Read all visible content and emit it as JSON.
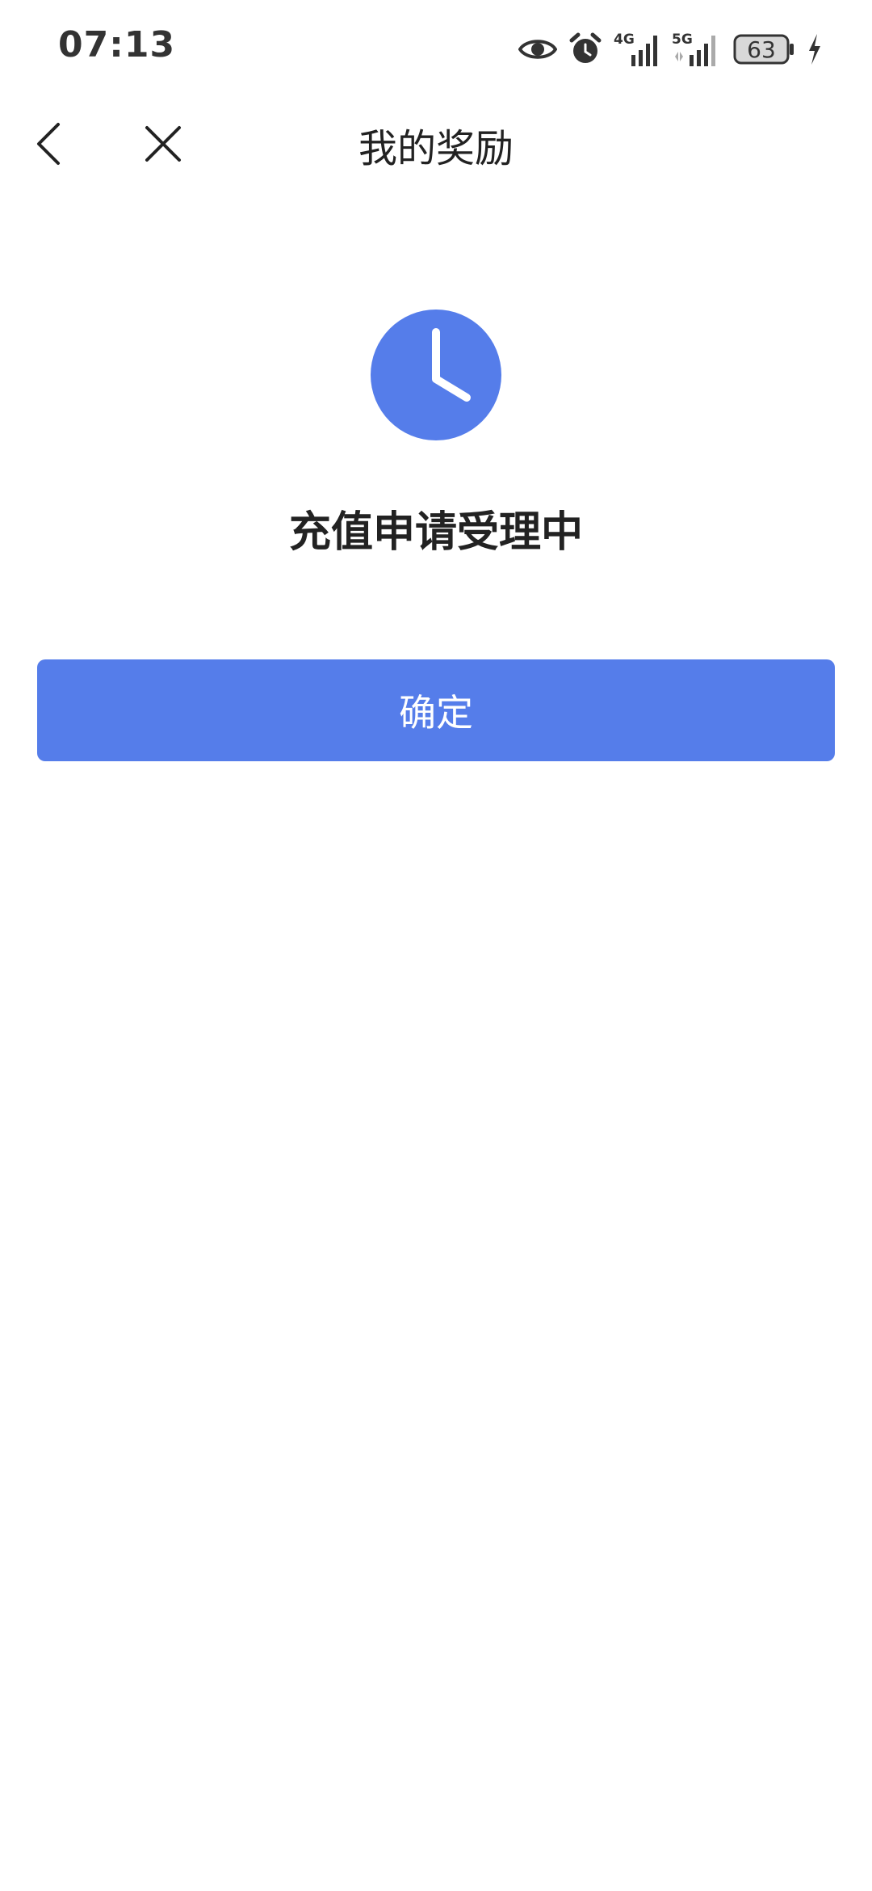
{
  "status_bar": {
    "time": "07:13",
    "network_4g": "4G",
    "network_5g": "5G",
    "battery_level": "63",
    "icons": [
      "eye-icon",
      "alarm-icon",
      "signal-4g-icon",
      "signal-5g-icon",
      "battery-icon",
      "charging-icon"
    ]
  },
  "nav": {
    "title": "我的奖励",
    "back_icon": "chevron-left-icon",
    "close_icon": "close-icon"
  },
  "result": {
    "icon": "clock-icon",
    "title": "充值申请受理中"
  },
  "actions": {
    "confirm_label": "确定"
  },
  "colors": {
    "accent": "#557DEA",
    "title_text": "#222222",
    "status_text": "#333333",
    "background": "#FFFFFF"
  }
}
